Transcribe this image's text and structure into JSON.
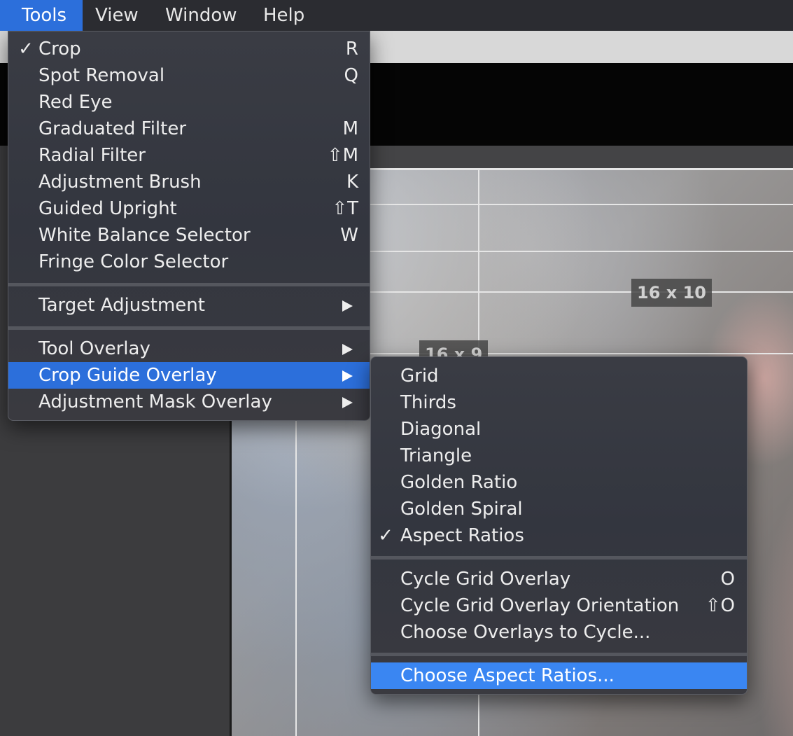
{
  "menubar": {
    "items": [
      {
        "label": "Tools",
        "active": true
      },
      {
        "label": "View"
      },
      {
        "label": "Window"
      },
      {
        "label": "Help"
      }
    ]
  },
  "canvas": {
    "ratio_labels": [
      "16 x 10",
      "16 x 9"
    ]
  },
  "tools_menu": {
    "items": [
      {
        "label": "Crop",
        "checked": true,
        "shortcut": "R"
      },
      {
        "label": "Spot Removal",
        "shortcut": "Q"
      },
      {
        "label": "Red Eye",
        "shortcut": ""
      },
      {
        "label": "Graduated Filter",
        "shortcut": "M"
      },
      {
        "label": "Radial Filter",
        "shortcut": "⇧M"
      },
      {
        "label": "Adjustment Brush",
        "shortcut": "K"
      },
      {
        "label": "Guided Upright",
        "shortcut": "⇧T"
      },
      {
        "label": "White Balance Selector",
        "shortcut": "W"
      },
      {
        "label": "Fringe Color Selector",
        "shortcut": ""
      },
      {
        "separator": true
      },
      {
        "label": "Target Adjustment",
        "submenu": true
      },
      {
        "separator": true
      },
      {
        "label": "Tool Overlay",
        "submenu": true
      },
      {
        "label": "Crop Guide Overlay",
        "submenu": true,
        "highlighted": true
      },
      {
        "label": "Adjustment Mask Overlay",
        "submenu": true
      }
    ]
  },
  "crop_guide_submenu": {
    "items": [
      {
        "label": "Grid"
      },
      {
        "label": "Thirds"
      },
      {
        "label": "Diagonal"
      },
      {
        "label": "Triangle"
      },
      {
        "label": "Golden Ratio"
      },
      {
        "label": "Golden Spiral"
      },
      {
        "label": "Aspect Ratios",
        "checked": true
      },
      {
        "separator": true
      },
      {
        "label": "Cycle Grid Overlay",
        "shortcut": "O"
      },
      {
        "label": "Cycle Grid Overlay Orientation",
        "shortcut": "⇧O"
      },
      {
        "label": "Choose Overlays to Cycle..."
      },
      {
        "separator": true
      },
      {
        "label": "Choose Aspect Ratios...",
        "highlighted": true
      }
    ]
  },
  "icons": {
    "check": "checkmark-icon",
    "submenu": "submenu-arrow-icon"
  },
  "colors": {
    "menubar_bg": "#2b2c31",
    "menu_highlight": "#2c6fdb",
    "submenu_highlight": "#3a86f2"
  }
}
